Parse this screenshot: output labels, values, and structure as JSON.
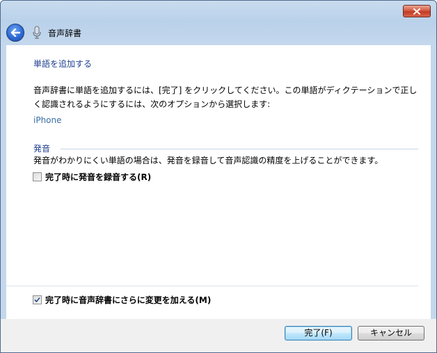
{
  "window": {
    "nav_title": "音声辞書"
  },
  "main": {
    "heading": "単語を追加する",
    "description": "音声辞書に単語を追加するには、[完了] をクリックしてください。この単語がディクテーションで正しく認識されるようにするには、次のオプションから選択します:",
    "word": "iPhone",
    "pronunciation_section": {
      "title": "発音",
      "description": "発音がわかりにくい単語の場合は、発音を録音して音声認識の精度を上げることができます。",
      "record_checkbox_label": "完了時に発音を録音する(R)",
      "record_checked": false
    },
    "more_changes_checkbox_label": "完了時に音声辞書にさらに変更を加える(M)",
    "more_changes_checked": true
  },
  "footer": {
    "finish_label": "完了(F)",
    "cancel_label": "キャンセル"
  },
  "colors": {
    "heading": "#1e3f8f",
    "word": "#3a6ea5",
    "close_button": "#c23a22",
    "back_button": "#2e6ad4"
  },
  "icons": {
    "close": "close-icon",
    "back": "back-arrow-icon",
    "app": "microphone-icon",
    "check": "checkmark-icon"
  }
}
